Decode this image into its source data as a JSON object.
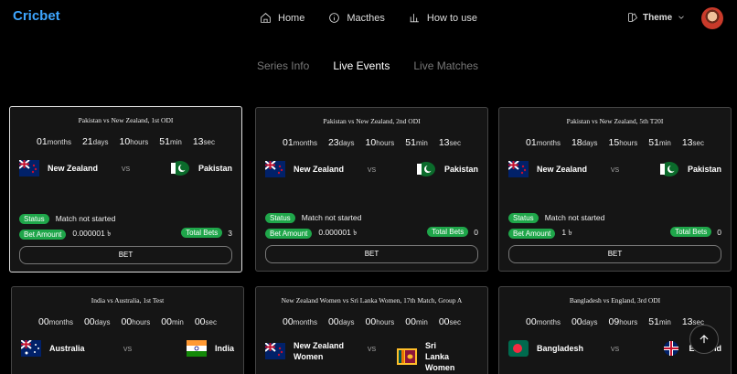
{
  "brand": "Cricbet",
  "nav": [
    {
      "label": "Home",
      "icon": "home-icon"
    },
    {
      "label": "Macthes",
      "icon": "info-icon"
    },
    {
      "label": "How to use",
      "icon": "bar-chart-icon"
    }
  ],
  "theme_label": "Theme",
  "tabs": [
    "Series Info",
    "Live Events",
    "Live Matches"
  ],
  "status_label": "Status",
  "bet_amount_label": "Bet Amount",
  "total_bets_label": "Total Bets",
  "bet_button": "BET",
  "vs": "VS",
  "units": {
    "months": "months",
    "days": "days",
    "hours": "hours",
    "min": "min",
    "sec": "sec"
  },
  "cards": [
    {
      "title": "Pakistan vs New Zealand, 1st ODI",
      "months": "01",
      "days": "21",
      "hours": "10",
      "min": "51",
      "sec": "13",
      "team1": "New Zealand",
      "team2": "Pakistan",
      "status": "Match not started",
      "bet_amount": "0.000001 ৳",
      "total_bets": "3"
    },
    {
      "title": "Pakistan vs New Zealand, 2nd ODI",
      "months": "01",
      "days": "23",
      "hours": "10",
      "min": "51",
      "sec": "13",
      "team1": "New Zealand",
      "team2": "Pakistan",
      "status": "Match not started",
      "bet_amount": "0.000001 ৳",
      "total_bets": "0"
    },
    {
      "title": "Pakistan vs New Zealand, 5th T20I",
      "months": "01",
      "days": "18",
      "hours": "15",
      "min": "51",
      "sec": "13",
      "team1": "New Zealand",
      "team2": "Pakistan",
      "status": "Match not started",
      "bet_amount": "1 ৳",
      "total_bets": "0"
    },
    {
      "title": "India vs Australia, 1st Test",
      "months": "00",
      "days": "00",
      "hours": "00",
      "min": "00",
      "sec": "00",
      "team1": "Australia",
      "team2": "India"
    },
    {
      "title": "New Zealand Women vs Sri Lanka Women, 17th Match, Group A",
      "months": "00",
      "days": "00",
      "hours": "00",
      "min": "00",
      "sec": "00",
      "team1": "New Zealand Women",
      "team2": "Sri Lanka Women"
    },
    {
      "title": "Bangladesh vs England, 3rd ODI",
      "months": "00",
      "days": "00",
      "hours": "09",
      "min": "51",
      "sec": "13",
      "team1": "Bangladesh",
      "team2": "England"
    }
  ]
}
